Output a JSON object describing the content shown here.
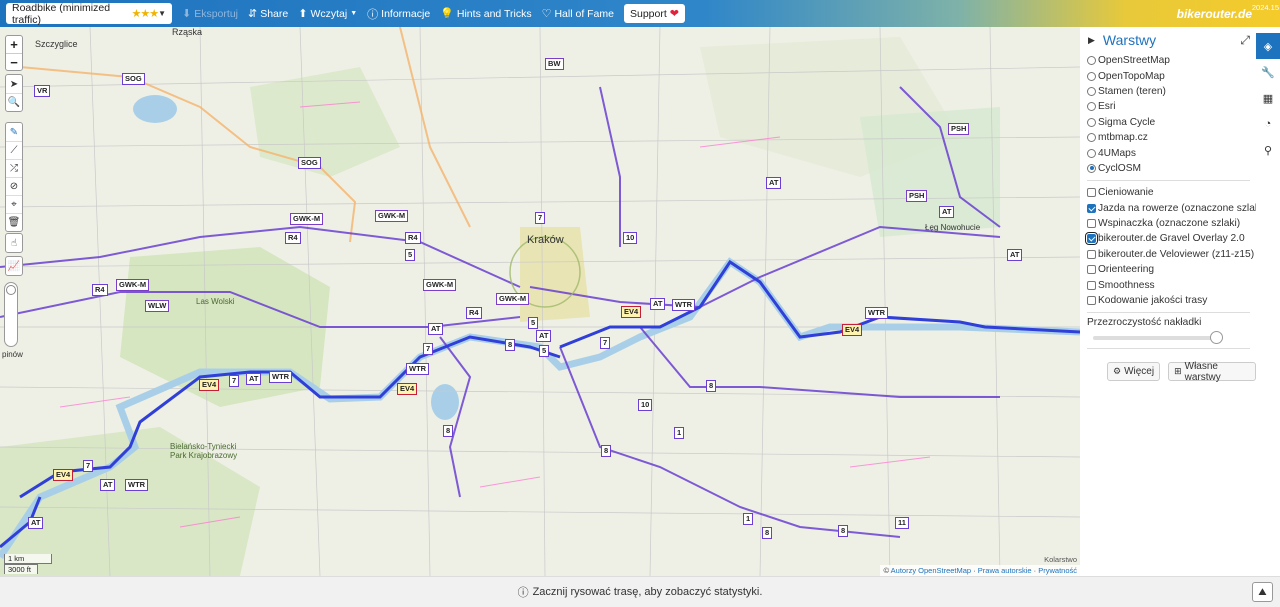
{
  "navbar": {
    "profile": "Roadbike (minimized traffic)",
    "profile_stars": "★★★",
    "export": "Eksportuj",
    "share": "Share",
    "load": "Wczytaj",
    "info": "Informacje",
    "hints": "Hints and Tricks",
    "hall_of_fame": "Hall of Fame",
    "support": "Support",
    "brand": "bikerouter.de",
    "version": "2024.15",
    "gradient_colors": [
      "#1e73be",
      "#f4cb2a"
    ]
  },
  "map": {
    "labels": {
      "city_center": "Kraków",
      "wola": "Las Wolski",
      "szczyglice": "Szczyglice",
      "rzaska": "Rząska",
      "nowa_huta": "Łęg Nowohucie",
      "park": "Bielańsko-Tyniecki Park Krajobrazowy",
      "left_edge": "pinów"
    },
    "route_badges": [
      "VR",
      "SOG",
      "SOG",
      "GWK-M",
      "GWK-M",
      "R4",
      "R4",
      "5",
      "GWK-M",
      "GWK-M",
      "R4",
      "WLW",
      "GWK-M",
      "5",
      "R4",
      "AT",
      "7",
      "8",
      "AT",
      "5",
      "7",
      "EV4",
      "AT",
      "WTR",
      "7",
      "10",
      "EV4",
      "WTR",
      "PSH",
      "AT",
      "PSH",
      "AT",
      "AT",
      "BW",
      "WTR",
      "EV4",
      "7",
      "AT",
      "WTR",
      "EV4",
      "7",
      "AT",
      "WTR",
      "EV4",
      "AT",
      "8",
      "8",
      "1",
      "8",
      "10",
      "1",
      "8",
      "8",
      "11"
    ],
    "scale_km": "1 km",
    "scale_ft": "3000 ft",
    "kolarstwo": "Kolarstwo",
    "attribution_prefix": "©",
    "attribution_authors": "Autorzy OpenStreetMap",
    "attribution_rights": "Prawa autorskie",
    "attribution_privacy": "Prywatność"
  },
  "layers": {
    "title": "Warstwy",
    "base": [
      {
        "label": "OpenStreetMap",
        "selected": false
      },
      {
        "label": "OpenTopoMap",
        "selected": false
      },
      {
        "label": "Stamen (teren)",
        "selected": false
      },
      {
        "label": "Esri",
        "selected": false
      },
      {
        "label": "Sigma Cycle",
        "selected": false
      },
      {
        "label": "mtbmap.cz",
        "selected": false
      },
      {
        "label": "4UMaps",
        "selected": false
      },
      {
        "label": "CyclOSM",
        "selected": true
      }
    ],
    "overlays": [
      {
        "label": "Cieniowanie",
        "checked": false
      },
      {
        "label": "Jazda na rowerze (oznaczone szlaki)",
        "checked": true
      },
      {
        "label": "Wspinaczka (oznaczone szlaki)",
        "checked": false
      },
      {
        "label": "bikerouter.de Gravel Overlay 2.0",
        "checked": true
      },
      {
        "label": "bikerouter.de Veloviewer (z11-z15)",
        "checked": false
      },
      {
        "label": "Orienteering",
        "checked": false
      },
      {
        "label": "Smoothness",
        "checked": false
      },
      {
        "label": "Kodowanie jakości trasy",
        "checked": false
      }
    ],
    "opacity_label": "Przezroczystość nakładki",
    "opacity_value": 1.0,
    "more_button": "Więcej",
    "custom_button": "Własne warstwy"
  },
  "bottom": {
    "message": "Zacznij rysować trasę, aby zobaczyć statystyki."
  }
}
